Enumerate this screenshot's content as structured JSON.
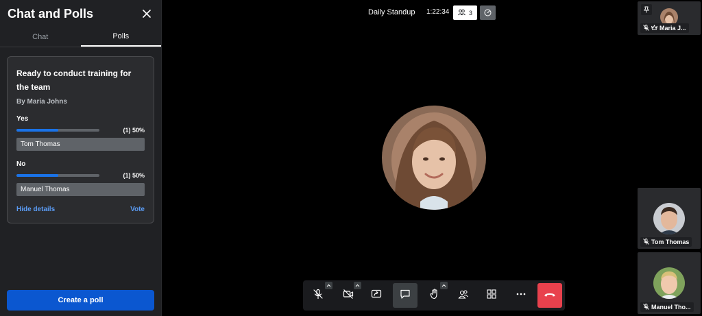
{
  "sidebar": {
    "title": "Chat and Polls",
    "tabs": [
      {
        "label": "Chat",
        "active": false
      },
      {
        "label": "Polls",
        "active": true
      }
    ],
    "poll": {
      "question": "Ready to conduct training for the team",
      "author": "By Maria Johns",
      "options": [
        {
          "label": "Yes",
          "result": "(1) 50%",
          "fraction": 0.5,
          "voter": "Tom Thomas"
        },
        {
          "label": "No",
          "result": "(1) 50%",
          "fraction": 0.5,
          "voter": "Manuel Thomas"
        }
      ],
      "hide_details": "Hide details",
      "vote": "Vote"
    },
    "create_poll": "Create a poll"
  },
  "topbar": {
    "meeting_title": "Daily Standup",
    "timer": "1:22:34",
    "participants_count": "3"
  },
  "tiles": {
    "top": {
      "name": "Maria J..."
    },
    "tom": {
      "name": "Tom Thomas"
    },
    "manuel": {
      "name": "Manuel Tho..."
    }
  },
  "colors": {
    "accent": "#1a73e8",
    "create_button": "#0b57d0",
    "end_call": "#e8414d",
    "link": "#5b9cf5"
  },
  "icons": [
    "close-icon",
    "people-icon",
    "speed-icon",
    "pin-icon",
    "mic-off-icon",
    "crown-icon",
    "camera-off-icon",
    "screen-share-icon",
    "chat-icon",
    "raise-hand-icon",
    "participants-icon",
    "grid-icon",
    "more-icon",
    "end-call-icon"
  ]
}
